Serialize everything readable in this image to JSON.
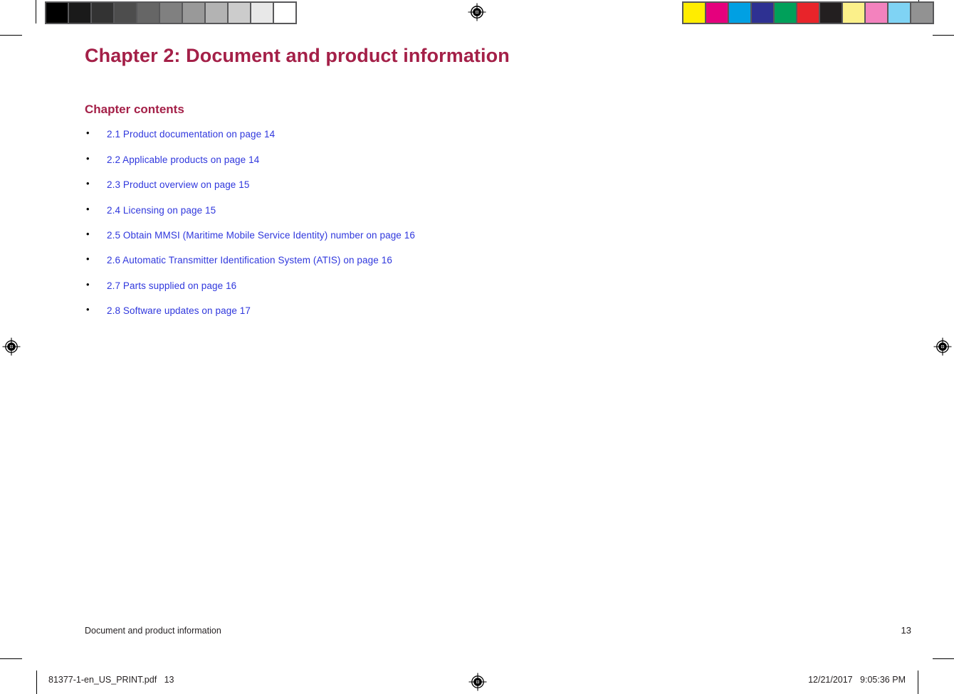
{
  "document": {
    "chapter_title": "Chapter 2: Document and product information",
    "contents_heading": "Chapter contents",
    "running_footer_text": "Document and product information",
    "folio": "13",
    "accent_color": "#a42048",
    "link_color": "#2f37dd"
  },
  "toc": {
    "bullet_glyph": "•",
    "items": [
      {
        "label": "2.1 Product documentation on page 14"
      },
      {
        "label": "2.2 Applicable products on page 14"
      },
      {
        "label": "2.3 Product overview on page 15"
      },
      {
        "label": "2.4 Licensing on page 15"
      },
      {
        "label": "2.5 Obtain MMSI (Maritime Mobile Service Identity) number on page 16"
      },
      {
        "label": "2.6 Automatic Transmitter Identification System (ATIS) on page 16"
      },
      {
        "label": "2.7 Parts supplied on page 16"
      },
      {
        "label": "2.8 Software updates on page 17"
      }
    ]
  },
  "viewer_strip": {
    "document_name": "81377-1-en_US_PRINT.pdf   13",
    "timestamp": "12/21/2017   9:05:36 PM"
  },
  "calibration": {
    "grayscale_label": "grayscale-step-wedge",
    "grayscale_swatches": [
      "#000000",
      "#1a1a1a",
      "#333333",
      "#4d4d4d",
      "#666666",
      "#808080",
      "#999999",
      "#b3b3b3",
      "#cccccc",
      "#e8e8e8",
      "#ffffff"
    ],
    "color_label": "process-color-bar",
    "color_swatches": [
      "#ffed00",
      "#e5007d",
      "#00a0e3",
      "#2e3192",
      "#00a05a",
      "#e8242a",
      "#231f20",
      "#fbf08a",
      "#f382be",
      "#7fd3f4",
      "#929292"
    ]
  },
  "marks": {
    "registration_icon": "registration-target-icon"
  }
}
